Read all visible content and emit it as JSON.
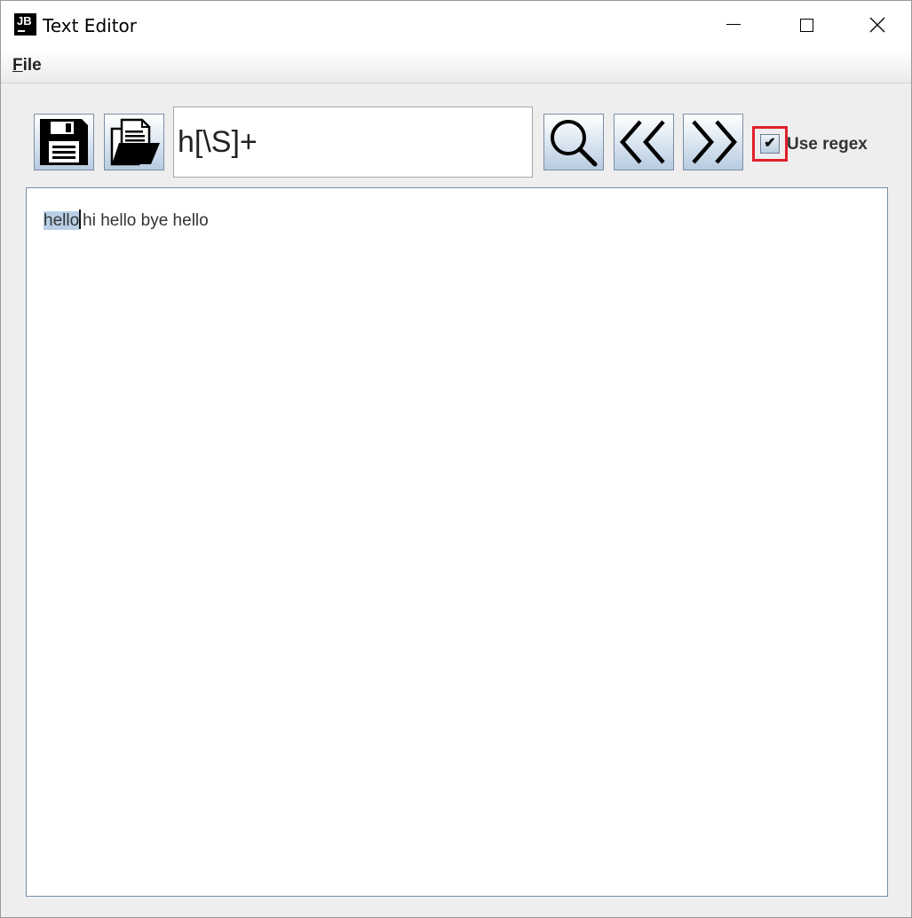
{
  "window": {
    "icon_text": "JB",
    "title": "Text Editor"
  },
  "menu": {
    "file_first": "F",
    "file_rest": "ile"
  },
  "toolbar": {
    "search_value": "h[\\S]+",
    "regex_checked": true,
    "regex_check_glyph": "✔",
    "regex_label": "Use regex",
    "buttons": [
      "save-icon",
      "open-folder-icon",
      "search-icon",
      "previous-icon",
      "next-icon"
    ]
  },
  "editor": {
    "selected_text": "hello",
    "rest_text": "hi hello bye hello"
  },
  "colors": {
    "selection": "#b8cfe5",
    "highlight_border": "#e0202a"
  }
}
